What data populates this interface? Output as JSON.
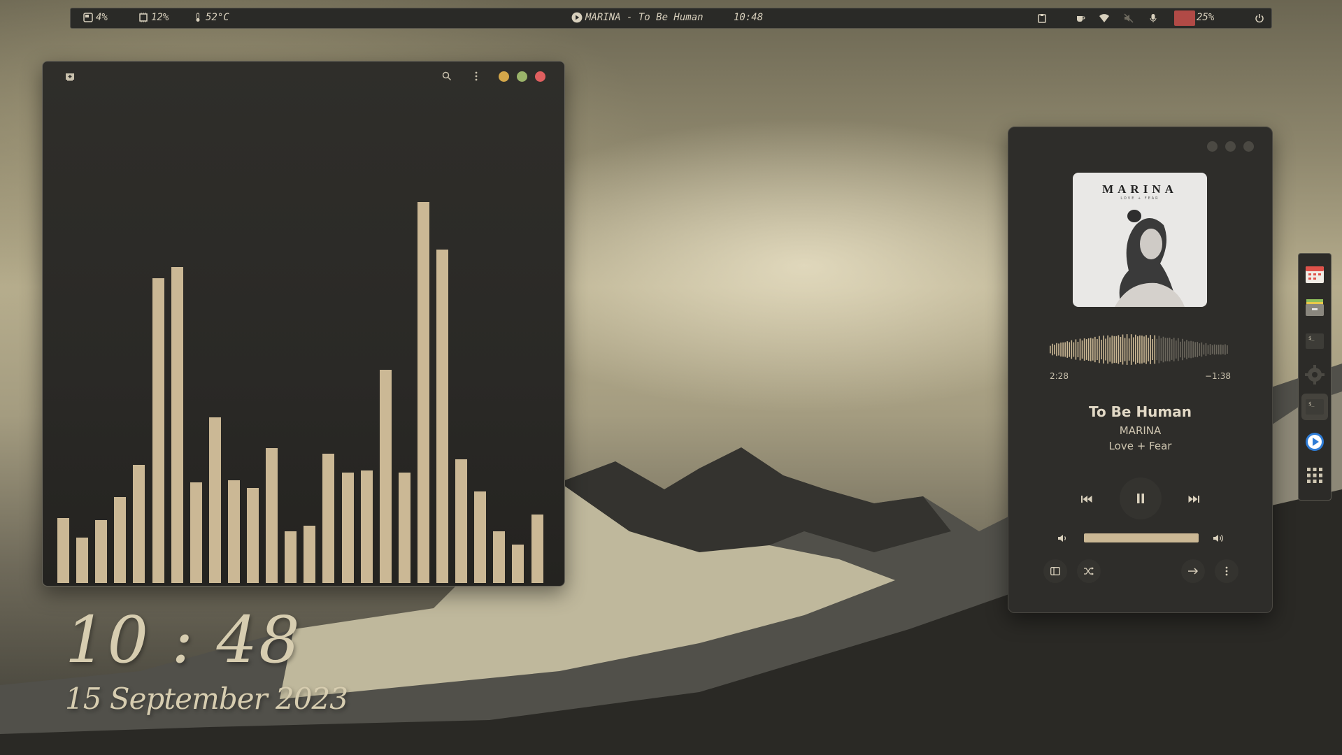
{
  "topbar": {
    "disk": "4%",
    "cpu": "12%",
    "temp": "52°C",
    "now_playing": "MARINA - To Be Human",
    "time": "10:48",
    "volume": "25%"
  },
  "visualizer": {
    "bar_levels": [
      0.17,
      0.12,
      0.165,
      0.225,
      0.31,
      0.8,
      0.83,
      0.265,
      0.435,
      0.27,
      0.25,
      0.355,
      0.135,
      0.15,
      0.34,
      0.29,
      0.295,
      0.56,
      0.29,
      1.0,
      0.875,
      0.325,
      0.24,
      0.135,
      0.1,
      0.18
    ]
  },
  "desktop_clock": {
    "time": "10 : 48",
    "date": "15 September 2023"
  },
  "player": {
    "album_art_title": "MARINA",
    "album_art_subtitle": "LOVE + FEAR",
    "elapsed": "2:28",
    "remaining": "−1:38",
    "progress": 0.6,
    "track": "To Be Human",
    "artist": "MARINA",
    "album": "Love + Fear",
    "volume_level": 1.0
  },
  "colors": {
    "accent": "#cbb895",
    "close": "#e05f5f",
    "minimize": "#d4a74a",
    "maximize": "#9bb46a",
    "panel_bg": "#2a2a27"
  },
  "dock_icons": [
    "calendar-icon",
    "files-icon",
    "terminal-icon",
    "settings-icon",
    "terminal-active-icon",
    "media-player-icon",
    "app-grid-icon"
  ]
}
